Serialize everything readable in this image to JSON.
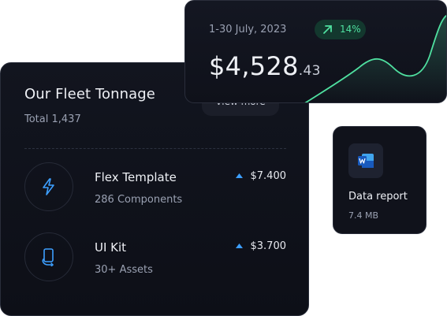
{
  "fleet": {
    "title": "Our Fleet Tonnage",
    "total": "Total 1,437",
    "view_more": "View more",
    "items": [
      {
        "name": "Flex Template",
        "sub": "286 Components",
        "price": "$7.400",
        "icon": "lightning-icon"
      },
      {
        "name": "UI Kit",
        "sub": "30+ Assets",
        "price": "$3.700",
        "icon": "phone-icon"
      }
    ]
  },
  "revenue": {
    "date_range": "1-30 July, 2023",
    "change": "14%",
    "amount_main": "$4,528",
    "amount_cents": ".43"
  },
  "report": {
    "name": "Data report",
    "size": "7.4 MB",
    "icon": "word-file-icon"
  },
  "colors": {
    "accent_green": "#4fe0a0",
    "accent_blue": "#3d9fff",
    "card_bg": "#10121b"
  }
}
